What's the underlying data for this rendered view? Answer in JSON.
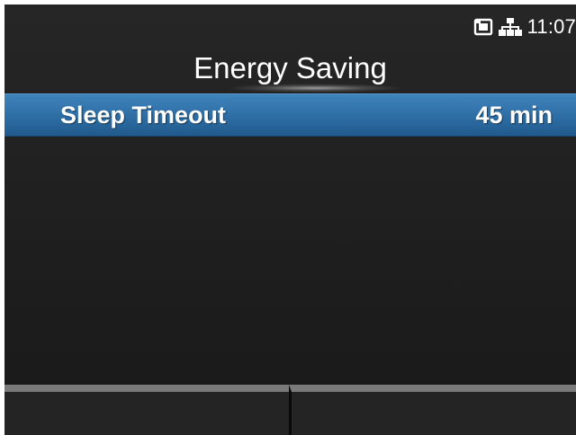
{
  "status_bar": {
    "clock": "11:07",
    "icons": [
      "sd-card-icon",
      "network-icon"
    ]
  },
  "header": {
    "title": "Energy Saving"
  },
  "menu": {
    "items": [
      {
        "label": "Sleep Timeout",
        "value": "45 min",
        "selected": true
      }
    ]
  },
  "softkeys": [
    "",
    ""
  ],
  "colors": {
    "background": "#1e1e1e",
    "selection": "#2d6da4",
    "text": "#ffffff",
    "softkey_border": "#7a7a7a"
  }
}
